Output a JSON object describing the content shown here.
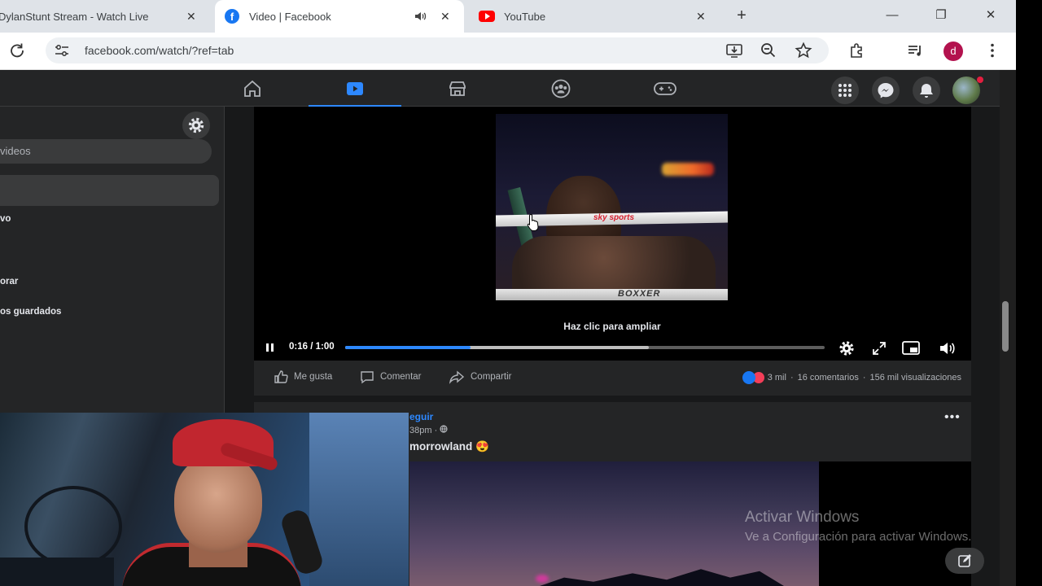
{
  "browser": {
    "tabs": [
      {
        "title": "DylanStunt Stream - Watch Live",
        "close": "✕"
      },
      {
        "title": "Video | Facebook",
        "close": "✕",
        "active": true
      },
      {
        "title": "YouTube",
        "close": "✕"
      }
    ],
    "new_tab": "+",
    "window": {
      "minimize": "—",
      "restore": "❐",
      "close": "✕"
    },
    "url": "facebook.com/watch/?ref=tab",
    "profile_initial": "d"
  },
  "sidebar": {
    "search_placeholder": "videos",
    "items": [
      "vo",
      "orar",
      "os guardados"
    ]
  },
  "video": {
    "hint": "Haz clic para ampliar",
    "current_time": "0:16",
    "duration": "1:00",
    "time_display": "0:16 / 1:00",
    "progress_fraction": 0.261,
    "buffered_fraction": 0.633,
    "overlay_brand": "sky sports",
    "overlay_brand2": "BOXXER"
  },
  "actions": {
    "like": "Me gusta",
    "comment": "Comentar",
    "share": "Compartir",
    "stats": {
      "reactions": "3 mil",
      "comments": "16 comentarios",
      "views": "156 mil visualizaciones",
      "separator": "·"
    }
  },
  "post2": {
    "follow": "eguir",
    "meta": "38pm · ",
    "text": "morrowland 😍",
    "more": "•••"
  },
  "watermark": {
    "title": "Activar Windows",
    "subtitle": "Ve a Configuración para activar Windows."
  },
  "colors": {
    "facebook_blue": "#1877f2",
    "accent": "#2d88ff",
    "youtube_red": "#ff0000",
    "dark_bg": "#18191a",
    "card_bg": "#242526"
  }
}
